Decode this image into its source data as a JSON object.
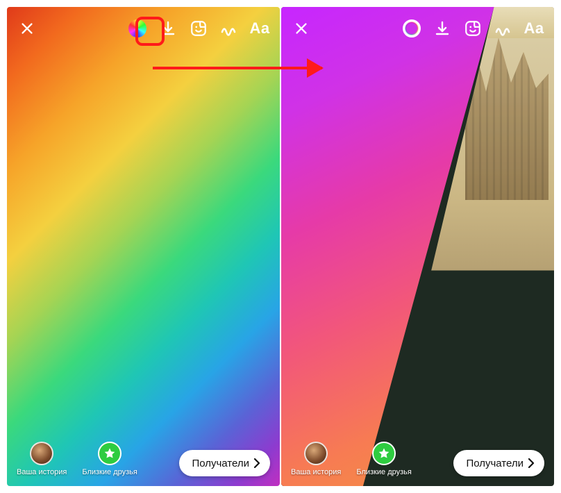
{
  "left": {
    "topbar": {
      "close": "close-icon",
      "gradient": "gradient-picker-icon",
      "download": "download-icon",
      "sticker": "sticker-icon",
      "draw": "draw-icon",
      "text_label": "Aa"
    },
    "bottom": {
      "your_story": "Ваша история",
      "close_friends": "Близкие друзья",
      "recipients": "Получатели"
    }
  },
  "right": {
    "topbar": {
      "close": "close-icon",
      "gradient": "gradient-picker-icon",
      "download": "download-icon",
      "sticker": "sticker-icon",
      "draw": "draw-icon",
      "text_label": "Aa"
    },
    "bottom": {
      "your_story": "Ваша история",
      "close_friends": "Близкие друзья",
      "recipients": "Получатели"
    }
  }
}
